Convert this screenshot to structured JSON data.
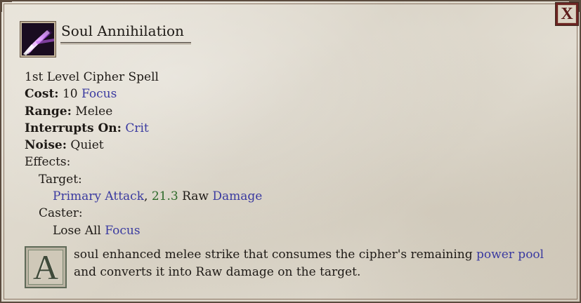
{
  "ability": {
    "title": "Soul Annihilation",
    "icon": "soul-annihilation-icon",
    "level_line": "1st Level Cipher Spell",
    "cost": {
      "label": "Cost:",
      "value": "10",
      "resource": "Focus"
    },
    "range": {
      "label": "Range:",
      "value": "Melee"
    },
    "interrupts": {
      "label": "Interrupts On:",
      "value": "Crit"
    },
    "noise": {
      "label": "Noise:",
      "value": "Quiet"
    },
    "effects_label": "Effects:",
    "target_label": "Target:",
    "target_effect": {
      "attack": "Primary Attack",
      "comma": ",",
      "amount": "21.3",
      "type": "Raw",
      "damage": "Damage"
    },
    "caster_label": "Caster:",
    "caster_effect": {
      "text": "Lose All",
      "resource": "Focus"
    },
    "description": {
      "drop_cap": "A",
      "part1": "soul enhanced melee strike that consumes the cipher's remaining",
      "link": "power pool",
      "part2": "and converts it into Raw damage on the target."
    }
  },
  "close_button": {
    "label": "X"
  },
  "colors": {
    "link": "#3a3aa0",
    "number": "#2e6a2a",
    "frame": "#5b4b3e",
    "close_border": "#6b2422"
  }
}
